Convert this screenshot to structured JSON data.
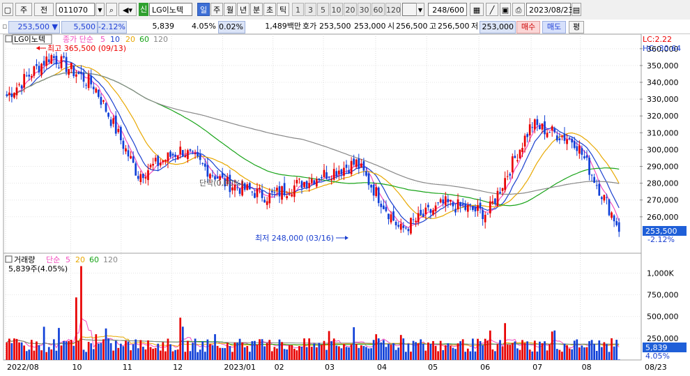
{
  "toolbar": {
    "type_label": "주",
    "prev_label": "전",
    "code": "011070",
    "stock_tag": "신",
    "stock_name": "LG이노텍",
    "period_buttons": [
      "일",
      "주",
      "월",
      "년",
      "분",
      "초",
      "틱"
    ],
    "active_period": "일",
    "interval_buttons": [
      "1",
      "3",
      "5",
      "10",
      "20",
      "30",
      "60",
      "120"
    ],
    "count": "248/600",
    "date": "2023/08/23"
  },
  "quote": {
    "price": "253,500",
    "change": "5,500",
    "change_pct": "-2.12%",
    "volume": "5,839",
    "volume_pct": "4.05%",
    "turnover_pct": "0.02%",
    "amount": "1,489백만",
    "ask_label": "호가",
    "ask": "253,500",
    "bid": "253,000",
    "open_label": "시",
    "open": "256,500",
    "high_label": "고",
    "high": "256,500",
    "low_label": "저",
    "low": "253,000",
    "buy_label": "매수",
    "sell_label": "매도",
    "eval_label": "평"
  },
  "chart_data": [
    {
      "type": "candlestick",
      "title": "LG이노텍",
      "legend": {
        "ma_label": "종가 단순",
        "periods": [
          "5",
          "10",
          "20",
          "60",
          "120"
        ],
        "colors": [
          "#f34dbf",
          "#1a3fcf",
          "#e8a800",
          "#17a317",
          "#888888"
        ]
      },
      "ylim": [
        240000,
        362000
      ],
      "y_ticks": [
        "360,000",
        "350,000",
        "340,000",
        "330,000",
        "320,000",
        "310,000",
        "300,000",
        "290,000",
        "280,000",
        "270,000",
        "260,000"
      ],
      "y_tick_values": [
        360000,
        350000,
        340000,
        330000,
        320000,
        310000,
        300000,
        290000,
        280000,
        270000,
        260000
      ],
      "x_labels": [
        "2022/08",
        "10",
        "11",
        "12",
        "2023/01",
        "02",
        "03",
        "04",
        "05",
        "06",
        "07",
        "08"
      ],
      "right_axis": {
        "lc": "LC:2.22",
        "hc": "HC:-30.64",
        "last_price": "253,500",
        "last_pct": "-2.12%"
      },
      "annotations": {
        "high": "최고 365,500 (09/13)",
        "low": "최저 248,000 (03/16)",
        "mid": "단락(0,00%)"
      },
      "key_points": [
        {
          "date": "2022/08",
          "close": 332000
        },
        {
          "date": "2022/09/13",
          "close": 356000
        },
        {
          "date": "2022/09",
          "close": 338000
        },
        {
          "date": "2022/10",
          "close": 285000
        },
        {
          "date": "2022/11",
          "close": 300000
        },
        {
          "date": "2022/12",
          "close": 280000
        },
        {
          "date": "2023/01",
          "close": 272000
        },
        {
          "date": "2023/02",
          "close": 283000
        },
        {
          "date": "2023/02/10",
          "close": 292000
        },
        {
          "date": "2023/03/16",
          "close": 252000
        },
        {
          "date": "2023/04",
          "close": 268000
        },
        {
          "date": "2023/05",
          "close": 262000
        },
        {
          "date": "2023/06",
          "close": 315000
        },
        {
          "date": "2023/07",
          "close": 305000
        },
        {
          "date": "2023/08/23",
          "close": 253500
        }
      ]
    },
    {
      "type": "bar",
      "title": "거래량",
      "legend": {
        "ma_label": "단순",
        "periods": [
          "5",
          "20",
          "60",
          "120"
        ],
        "colors": [
          "#f34dbf",
          "#e8a800",
          "#17a317",
          "#888888"
        ]
      },
      "value_label": "5,839주(4.05%)",
      "ylim": [
        0,
        1100000
      ],
      "y_ticks": [
        "1,000K",
        "750,000",
        "500,000",
        "250,000"
      ],
      "y_tick_values": [
        1000000,
        750000,
        500000,
        250000
      ],
      "last_volume": "5,839",
      "last_pct": "4.05%",
      "x_end_label": "08/23"
    }
  ]
}
